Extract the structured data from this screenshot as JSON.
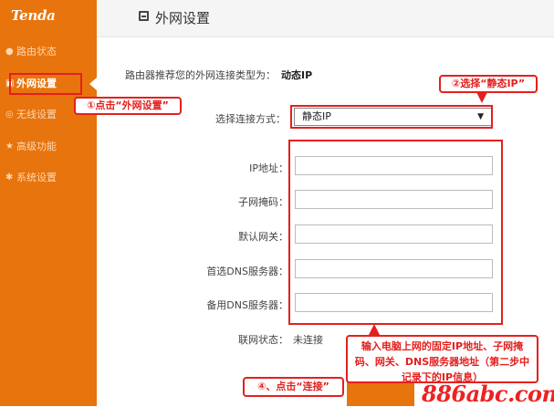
{
  "brand": {
    "logo_text": "Tenda"
  },
  "sidebar": {
    "items": [
      {
        "label": "路由状态",
        "icon": "circle-icon"
      },
      {
        "label": "外网设置",
        "icon": "monitor-icon",
        "active": true
      },
      {
        "label": "无线设置",
        "icon": "wireless-icon"
      },
      {
        "label": "高级功能",
        "icon": "star-icon"
      },
      {
        "label": "系统设置",
        "icon": "gear-icon"
      }
    ]
  },
  "header": {
    "title": "外网设置",
    "icon": "monitor-icon"
  },
  "recommend": {
    "label": "路由器推荐您的外网连接类型为：",
    "value": "动态IP"
  },
  "form": {
    "connection_type_label": "选择连接方式：",
    "connection_type_value": "静态IP",
    "fields": [
      {
        "label": "IP地址：",
        "value": ""
      },
      {
        "label": "子网掩码：",
        "value": ""
      },
      {
        "label": "默认网关：",
        "value": ""
      },
      {
        "label": "首选DNS服务器：",
        "value": ""
      },
      {
        "label": "备用DNS服务器：",
        "value": ""
      }
    ],
    "status_label": "联网状态：",
    "status_value": "未连接"
  },
  "annotations": {
    "step1": "①点击“外网设置”",
    "step2": "②选择“静态IP”",
    "step3": "输入电脑上网的固定IP地址、子网掩码、网关、DNS服务器地址（第二步中记录下的IP信息）",
    "step4": "④、点击“连接”"
  },
  "watermark": "886abc.com",
  "colors": {
    "sidebar": "#e8740d",
    "highlight": "#e3201e"
  }
}
